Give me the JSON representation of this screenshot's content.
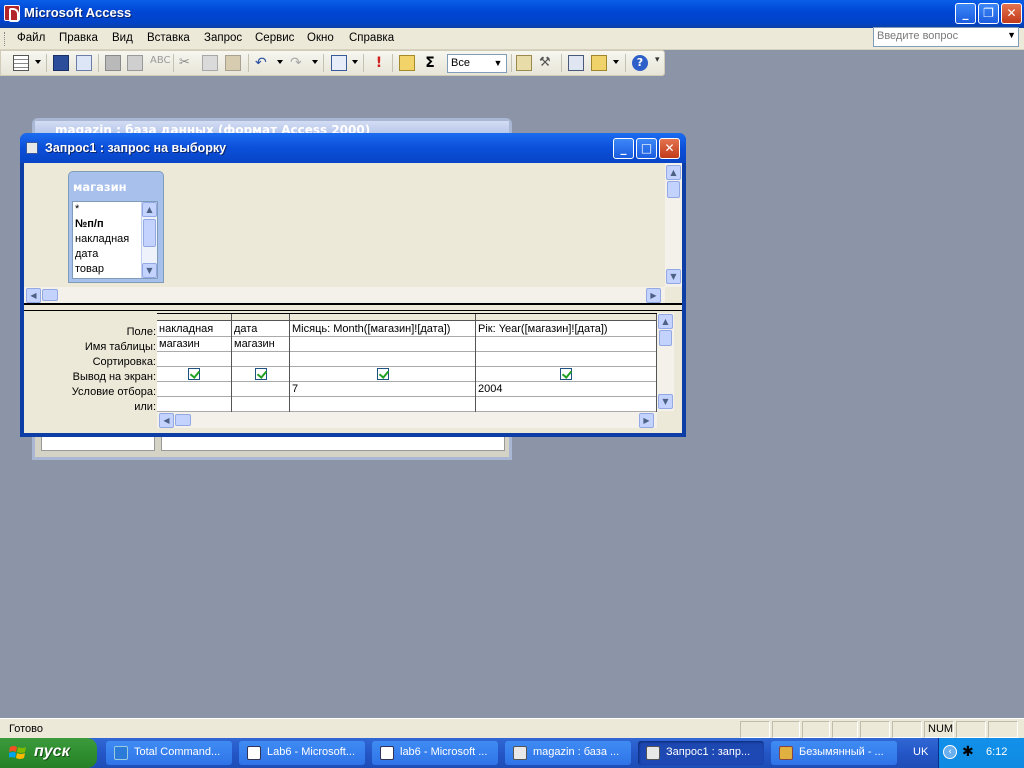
{
  "app": {
    "title": "Microsoft Access"
  },
  "menu": {
    "items": [
      "Файл",
      "Правка",
      "Вид",
      "Вставка",
      "Запрос",
      "Сервис",
      "Окно",
      "Справка"
    ],
    "help_placeholder": "Введите вопрос"
  },
  "toolbar": {
    "top_values_combo": "Все",
    "icons": [
      "datasheet-view-icon",
      "save-icon",
      "search-icon",
      "print-icon",
      "print-preview-icon",
      "spelling-icon",
      "cut-icon",
      "copy-icon",
      "paste-icon",
      "undo-icon",
      "redo-icon",
      "query-type-icon",
      "run-icon",
      "show-table-icon",
      "totals-icon",
      "properties-icon",
      "build-icon",
      "database-window-icon",
      "new-object-icon",
      "help-icon"
    ]
  },
  "db_window": {
    "title": "magazin : база данных (формат Access 2000)"
  },
  "query_window": {
    "title": "Запрос1 : запрос на выборку",
    "table": {
      "name": "магазин",
      "fields": [
        "*",
        "№п/п",
        "накладная",
        "дата",
        "товар"
      ]
    },
    "row_labels": [
      "Поле:",
      "Имя таблицы:",
      "Сортировка:",
      "Вывод на экран:",
      "Условие отбора:",
      "или:"
    ],
    "columns": [
      {
        "field": "накладная",
        "table": "магазин",
        "sort": "",
        "show": true,
        "criteria": "",
        "or": ""
      },
      {
        "field": "дата",
        "table": "магазин",
        "sort": "",
        "show": true,
        "criteria": "",
        "or": ""
      },
      {
        "field": "Місяць: Month([магазин]![дата])",
        "table": "",
        "sort": "",
        "show": true,
        "criteria": "7",
        "or": ""
      },
      {
        "field": "Рік: Year([магазин]![дата])",
        "table": "",
        "sort": "",
        "show": true,
        "criteria": "2004",
        "or": ""
      }
    ]
  },
  "status": {
    "text": "Готово",
    "num": "NUM"
  },
  "taskbar": {
    "start_label": "пуск",
    "tasks": [
      "Total Command...",
      "Lab6 - Microsoft...",
      "lab6 - Microsoft ...",
      "magazin : база ...",
      "Запрос1 : запр...",
      "Безымянный - ..."
    ],
    "lang": "UK",
    "clock": "6:12"
  },
  "colors": {
    "titlebar": "#0046d5",
    "desktop": "#8c94a8",
    "start": "#2f8f2f"
  }
}
